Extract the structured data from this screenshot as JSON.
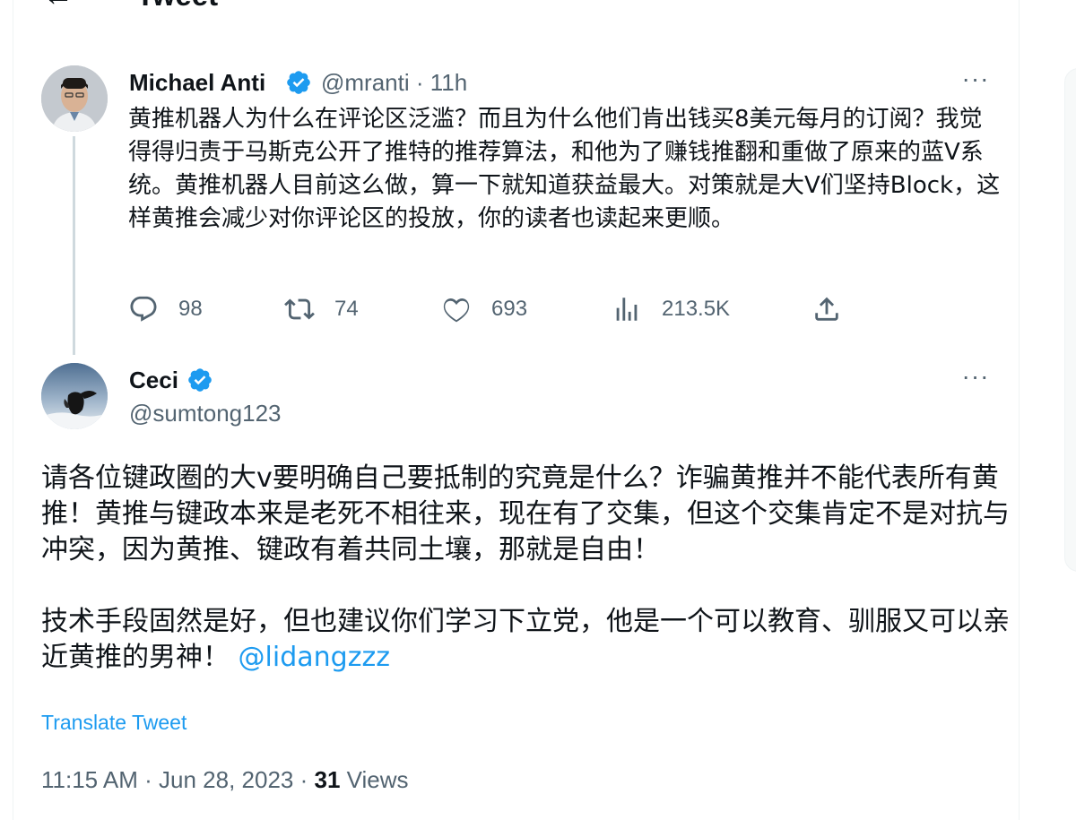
{
  "header": {
    "back_icon": "arrow-left-icon",
    "title": "Tweet"
  },
  "tweet1": {
    "author_name": "Michael Anti",
    "handle_time": "@mranti · 11h",
    "text": "黄推机器人为什么在评论区泛滥？而且为什么他们肯出钱买8美元每月的订阅？我觉得得归责于马斯克公开了推特的推荐算法，和他为了赚钱推翻和重做了原来的蓝V系统。黄推机器人目前这么做，算一下就知道获益最大。对策就是大V们坚持Block，这样黄推会减少对你评论区的投放，你的读者也读起来更顺。",
    "more_label": "···",
    "replies": "98",
    "retweets": "74",
    "likes": "693",
    "views": "213.5K"
  },
  "tweet2": {
    "author_name": "Ceci",
    "handle": "@sumtong123",
    "more_label": "···",
    "paragraph1": "请各位键政圈的大v要明确自己要抵制的究竟是什么？诈骗黄推并不能代表所有黄推！黄推与键政本来是老死不相往来，现在有了交集，但这个交集肯定不是对抗与冲突，因为黄推、键政有着共同土壤，那就是自由！",
    "paragraph2": "技术手段固然是好，但也建议你们学习下立党，他是一个可以教育、驯服又可以亲近黄推的男神！",
    "mention": "@lidangzzz",
    "translate": "Translate Tweet",
    "time_date": "11:15 AM · Jun 28, 2023 · ",
    "views_count": "31",
    "views_label": " Views"
  },
  "colors": {
    "accent": "#1d9bf0",
    "secondary_text": "#536471",
    "primary_text": "#0f1419",
    "border": "#eff3f4"
  }
}
